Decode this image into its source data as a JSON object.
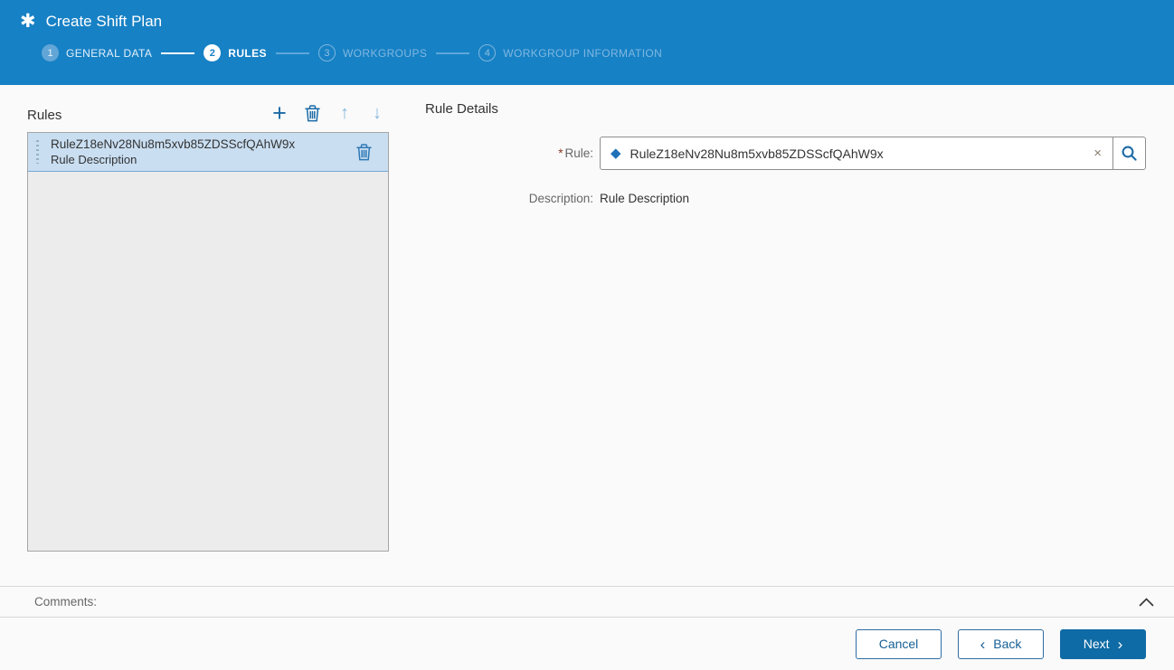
{
  "header": {
    "icon_glyph": "✱",
    "title": "Create Shift Plan",
    "steps": [
      {
        "number": "1",
        "label": "GENERAL DATA",
        "state": "completed"
      },
      {
        "number": "2",
        "label": "RULES",
        "state": "active"
      },
      {
        "number": "3",
        "label": "WORKGROUPS",
        "state": "upcoming"
      },
      {
        "number": "4",
        "label": "WORKGROUP INFORMATION",
        "state": "upcoming"
      }
    ]
  },
  "rules_panel": {
    "title": "Rules",
    "toolbar": {
      "add_glyph": "+",
      "move_up_glyph": "↑",
      "move_down_glyph": "↓"
    },
    "items": [
      {
        "name": "RuleZ18eNv28Nu8m5xvb85ZDSScfQAhW9x",
        "description": "Rule Description",
        "selected": true
      }
    ]
  },
  "details_panel": {
    "title": "Rule Details",
    "rule_field": {
      "required_marker": "*",
      "label": "Rule:",
      "diamond_glyph": "◆",
      "value": "RuleZ18eNv28Nu8m5xvb85ZDSScfQAhW9x",
      "clear_glyph": "×"
    },
    "description_row": {
      "label": "Description:",
      "value": "Rule Description"
    }
  },
  "comments": {
    "label": "Comments:"
  },
  "footer": {
    "cancel_label": "Cancel",
    "back_chevron": "‹",
    "back_label": "Back",
    "next_label": "Next",
    "next_chevron": "›"
  },
  "colors": {
    "header_bar": "#1781c5",
    "accent_dark_blue": "#1b6ba6",
    "primary_button": "#0f6ba5",
    "selected_row_bg": "#c9def1",
    "selected_row_border": "#74a9d8",
    "list_bg": "#ececec",
    "required_asterisk": "#8b3a26",
    "disabled_icon": "#86b7db"
  }
}
